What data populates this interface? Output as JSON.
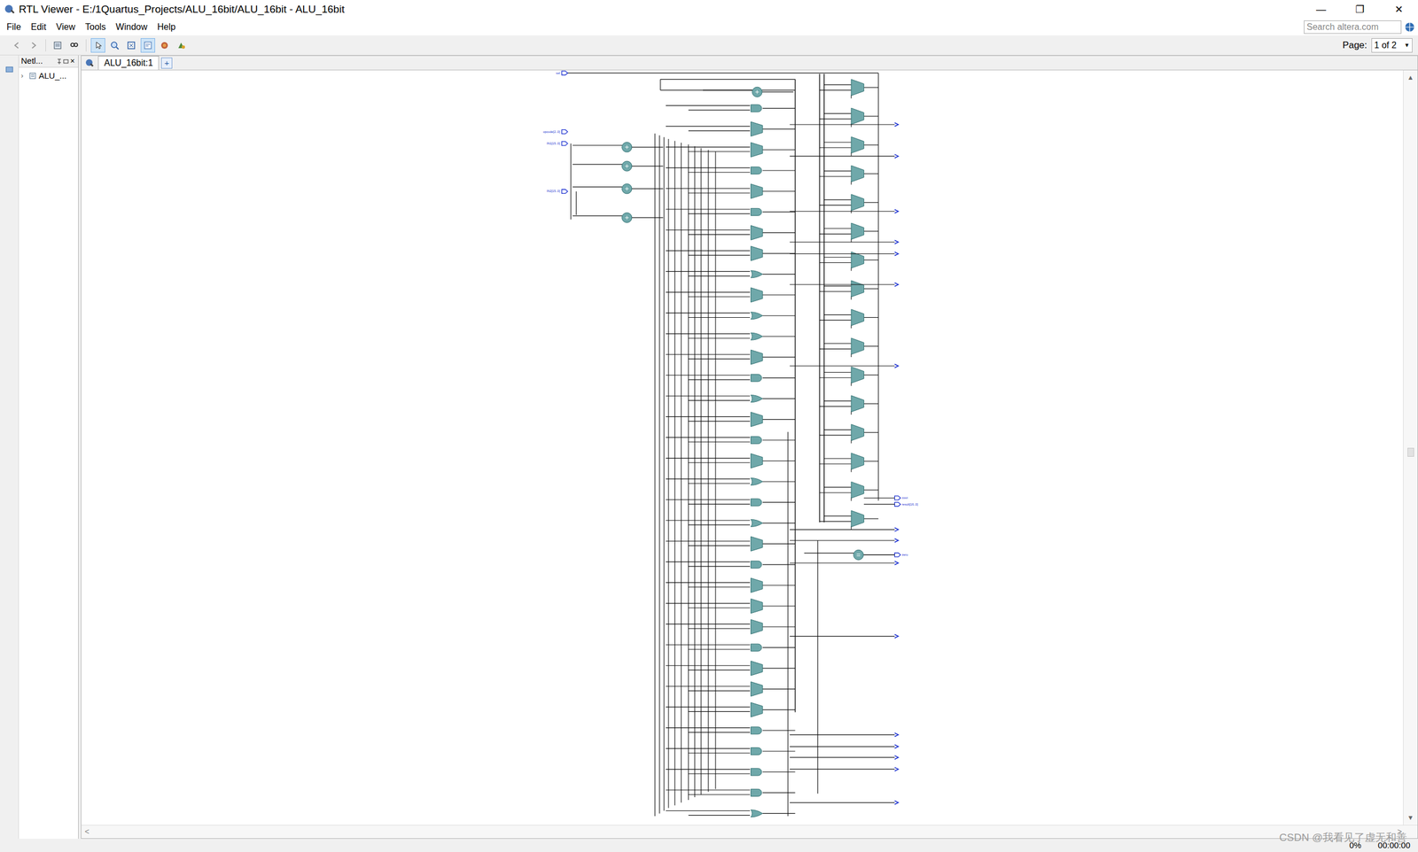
{
  "window": {
    "title": "RTL Viewer - E:/1Quartus_Projects/ALU_16bit/ALU_16bit - ALU_16bit",
    "controls": [
      "—",
      "❐",
      "✕"
    ]
  },
  "menu": [
    "File",
    "Edit",
    "View",
    "Tools",
    "Window",
    "Help"
  ],
  "search": {
    "placeholder": "Search altera.com"
  },
  "toolbar": [
    {
      "kind": "back",
      "selected": false
    },
    {
      "kind": "forward",
      "selected": false
    },
    {
      "kind": "netlist",
      "selected": false
    },
    {
      "kind": "find",
      "selected": false
    },
    {
      "kind": "select",
      "selected": true
    },
    {
      "kind": "zoom",
      "selected": false
    },
    {
      "kind": "fit",
      "selected": false
    },
    {
      "kind": "hierarchy",
      "selected": true
    },
    {
      "kind": "filter",
      "selected": false
    },
    {
      "kind": "run",
      "selected": false
    }
  ],
  "page": {
    "label": "Page:",
    "value": "1 of 2"
  },
  "netlist_panel": {
    "title": "Netl...",
    "close": "×",
    "tree": [
      {
        "label": "ALU_...",
        "expanded": false
      }
    ]
  },
  "tab": {
    "label": "ALU_16bit:1",
    "add": "+"
  },
  "schematic": {
    "ports": [
      {
        "label": "sel",
        "kind": "input"
      },
      {
        "label": "opcode[2..0]",
        "kind": "input"
      },
      {
        "label": "IN1[15..0]",
        "kind": "input"
      },
      {
        "label": "IN2[15..0]",
        "kind": "input"
      },
      {
        "label": "cout",
        "kind": "output"
      },
      {
        "label": "result[16..0]",
        "kind": "output"
      },
      {
        "label": "zero",
        "kind": "output"
      }
    ],
    "adders": [
      {
        "kind": "add"
      },
      {
        "kind": "add"
      },
      {
        "kind": "add"
      },
      {
        "kind": "add"
      },
      {
        "kind": "add"
      },
      {
        "kind": "equal"
      }
    ],
    "column1": [
      {
        "kind": "and"
      },
      {
        "kind": "mux"
      },
      {
        "kind": "mux"
      },
      {
        "kind": "and"
      },
      {
        "kind": "mux"
      },
      {
        "kind": "and"
      },
      {
        "kind": "mux"
      },
      {
        "kind": "mux"
      },
      {
        "kind": "or"
      },
      {
        "kind": "mux"
      },
      {
        "kind": "or"
      },
      {
        "kind": "or"
      },
      {
        "kind": "mux"
      },
      {
        "kind": "and"
      },
      {
        "kind": "or"
      },
      {
        "kind": "mux"
      },
      {
        "kind": "and"
      },
      {
        "kind": "mux"
      },
      {
        "kind": "or"
      },
      {
        "kind": "and"
      },
      {
        "kind": "or"
      },
      {
        "kind": "mux"
      },
      {
        "kind": "and"
      },
      {
        "kind": "mux"
      },
      {
        "kind": "mux"
      },
      {
        "kind": "mux"
      },
      {
        "kind": "and"
      },
      {
        "kind": "mux"
      },
      {
        "kind": "mux"
      },
      {
        "kind": "mux"
      },
      {
        "kind": "and"
      },
      {
        "kind": "and"
      },
      {
        "kind": "and"
      },
      {
        "kind": "and"
      },
      {
        "kind": "or"
      }
    ],
    "column2": [
      {
        "kind": "mux"
      },
      {
        "kind": "mux"
      },
      {
        "kind": "mux"
      },
      {
        "kind": "mux"
      },
      {
        "kind": "mux"
      },
      {
        "kind": "mux"
      },
      {
        "kind": "mux"
      },
      {
        "kind": "mux"
      },
      {
        "kind": "mux"
      },
      {
        "kind": "mux"
      },
      {
        "kind": "mux"
      },
      {
        "kind": "mux"
      },
      {
        "kind": "mux"
      },
      {
        "kind": "mux"
      },
      {
        "kind": "mux"
      },
      {
        "kind": "mux"
      }
    ],
    "output_pins": [
      {
        "kind": "bus"
      },
      {
        "kind": "bus"
      },
      {
        "kind": "bus"
      },
      {
        "kind": "bus"
      },
      {
        "kind": "bus"
      },
      {
        "kind": "bus"
      },
      {
        "kind": "bus"
      },
      {
        "kind": "bus"
      },
      {
        "kind": "bus"
      },
      {
        "kind": "bus"
      },
      {
        "kind": "bus"
      },
      {
        "kind": "bus"
      },
      {
        "kind": "bus"
      },
      {
        "kind": "bus"
      },
      {
        "kind": "bus"
      },
      {
        "kind": "bus"
      }
    ]
  },
  "scroll": {
    "vertical": 0.5,
    "up": "▲",
    "down": "▼",
    "left": "<",
    "right": ">"
  },
  "status": {
    "progress": "0%",
    "time": "00:00:00"
  },
  "watermark": "CSDN @我看见了虚无和善"
}
